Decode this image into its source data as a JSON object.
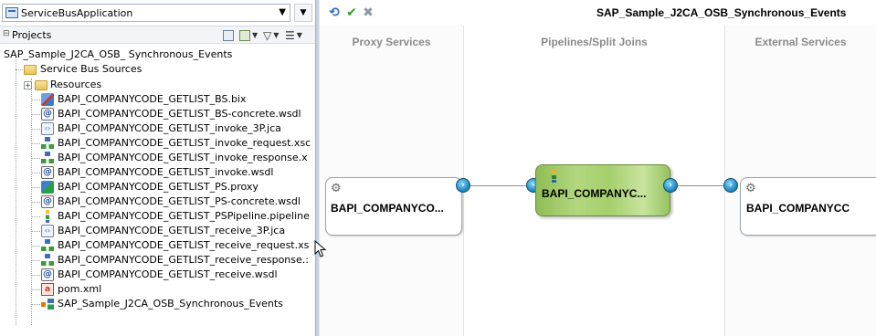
{
  "app_selector": {
    "value": "ServiceBusApplication",
    "menu_symbol": "▼"
  },
  "projects_header": {
    "label": "Projects"
  },
  "tree": {
    "root": "SAP_Sample_J2CA_OSB_ Synchronous_Events",
    "service_bus_sources": "Service Bus Sources",
    "resources": "Resources",
    "files": [
      {
        "label": "BAPI_COMPANYCODE_GETLIST_BS.bix",
        "icon": "business-service-icon"
      },
      {
        "label": "BAPI_COMPANYCODE_GETLIST_BS-concrete.wsdl",
        "icon": "wsdl-icon"
      },
      {
        "label": "BAPI_COMPANYCODE_GETLIST_invoke_3P.jca",
        "icon": "jca-icon"
      },
      {
        "label": "BAPI_COMPANYCODE_GETLIST_invoke_request.xsc",
        "icon": "xsd-icon"
      },
      {
        "label": "BAPI_COMPANYCODE_GETLIST_invoke_response.x",
        "icon": "xsd-icon"
      },
      {
        "label": "BAPI_COMPANYCODE_GETLIST_invoke.wsdl",
        "icon": "wsdl-icon"
      },
      {
        "label": "BAPI_COMPANYCODE_GETLIST_PS.proxy",
        "icon": "proxy-service-icon"
      },
      {
        "label": "BAPI_COMPANYCODE_GETLIST_PS-concrete.wsdl",
        "icon": "wsdl-icon"
      },
      {
        "label": "BAPI_COMPANYCODE_GETLIST_PSPipeline.pipeline",
        "icon": "pipeline-icon"
      },
      {
        "label": "BAPI_COMPANYCODE_GETLIST_receive_3P.jca",
        "icon": "jca-icon"
      },
      {
        "label": "BAPI_COMPANYCODE_GETLIST_receive_request.xs",
        "icon": "xsd-icon"
      },
      {
        "label": "BAPI_COMPANYCODE_GETLIST_receive_response.:",
        "icon": "xsd-icon"
      },
      {
        "label": "BAPI_COMPANYCODE_GETLIST_receive.wsdl",
        "icon": "wsdl-icon"
      }
    ],
    "pom": "pom.xml",
    "overview": "SAP_Sample_J2CA_OSB_Synchronous_Events"
  },
  "editor": {
    "title": "SAP_Sample_J2CA_OSB_Synchronous_Events",
    "columns": {
      "proxy": "Proxy Services",
      "pipelines": "Pipelines/Split Joins",
      "external": "External Services"
    },
    "nodes": {
      "proxy_label": "BAPI_COMPANYCO...",
      "pipeline_label": "BAPI_COMPANYC...",
      "external_label": "BAPI_COMPANYCC"
    }
  },
  "colors": {
    "pipeline_fill": "#a5cf6c",
    "port_blue": "#1d7fb8",
    "column_header": "#8a8a8a",
    "check_green": "#2e9e2e"
  }
}
